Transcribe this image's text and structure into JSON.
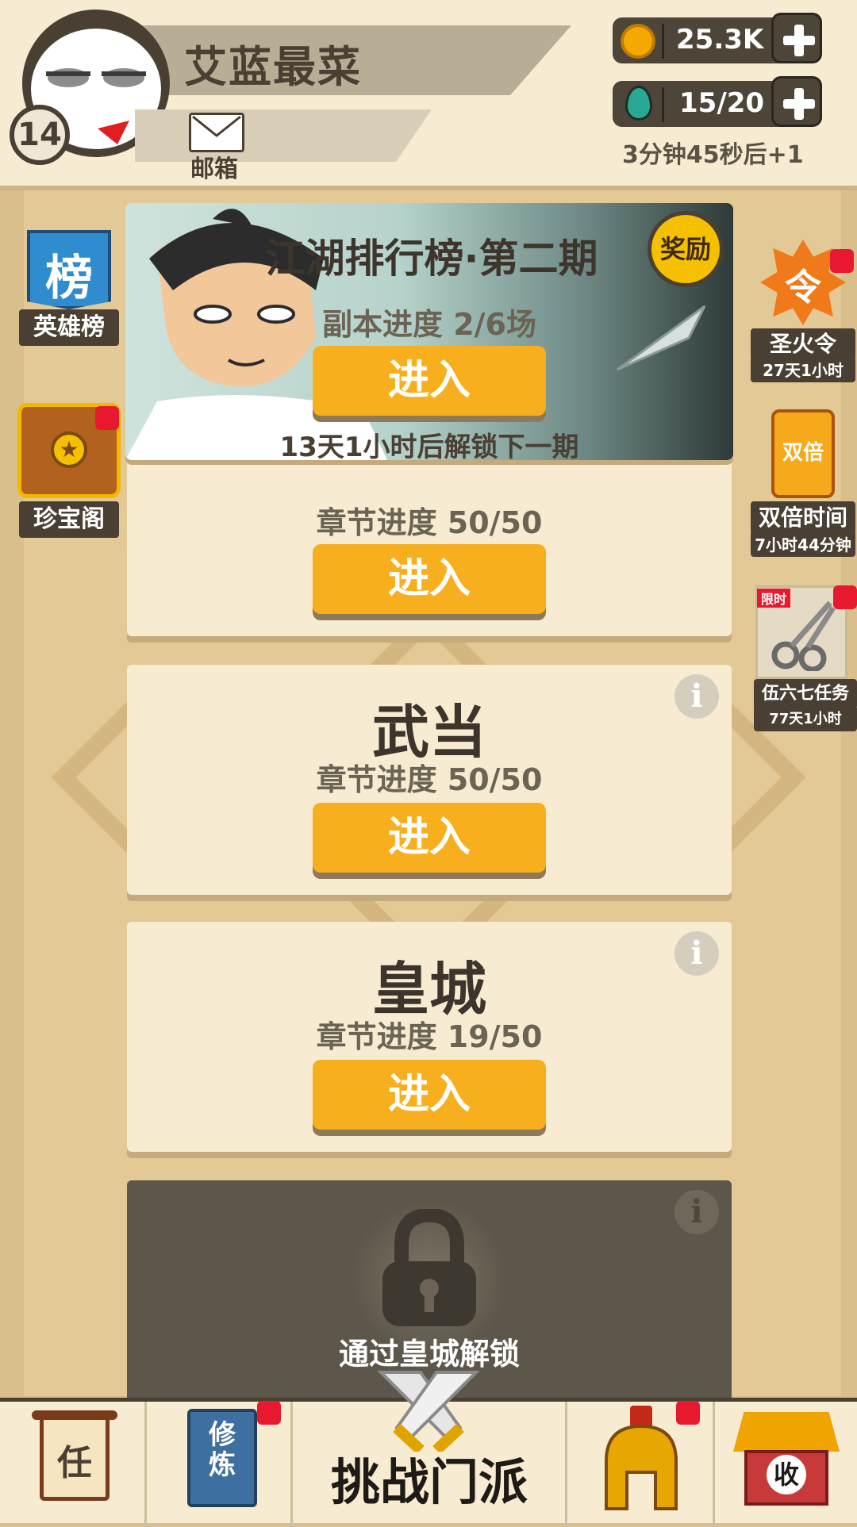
{
  "player": {
    "name": "艾蓝最菜",
    "level": "14",
    "mail_label": "邮箱"
  },
  "resources": {
    "coins": "25.3K",
    "energy": "15/20",
    "energy_timer": "3分钟45秒后+1"
  },
  "left_side": {
    "hero_rank_label": "英雄榜",
    "hero_rank_icon_text": "榜",
    "treasure_label": "珍宝阁"
  },
  "right_side": {
    "flame_label": "圣火令",
    "flame_timer": "27天1小时",
    "flame_icon_text": "令",
    "double_label": "双倍时间",
    "double_timer": "7小时44分钟",
    "double_icon_text": "双倍",
    "task_label": "伍六七任务",
    "task_timer": "77天1小时",
    "task_tag": "限时"
  },
  "event_banner": {
    "title": "江湖排行榜·第二期",
    "progress": "副本进度 2/6场",
    "enter": "进入",
    "unlock_note": "13天1小时后解锁下一期",
    "reward_badge": "奖励"
  },
  "chapters": [
    {
      "title": "",
      "progress": "章节进度 50/50",
      "enter": "进入"
    },
    {
      "title": "武当",
      "progress": "章节进度 50/50",
      "enter": "进入",
      "info": "i"
    },
    {
      "title": "皇城",
      "progress": "章节进度 19/50",
      "enter": "进入",
      "info": "i"
    }
  ],
  "locked_chapter": {
    "text": "通过皇城解锁",
    "info": "i"
  },
  "bottom_nav": {
    "task_icon_text": "任",
    "cultivate_icon_text": "修炼",
    "challenge_label": "挑战门派",
    "collect_icon_text": "收"
  },
  "colors": {
    "button": "#f7af1e",
    "card": "#f7ecd2",
    "dark": "#4a3f33",
    "badge": "#e8192f",
    "background": "#d9bf8c"
  }
}
